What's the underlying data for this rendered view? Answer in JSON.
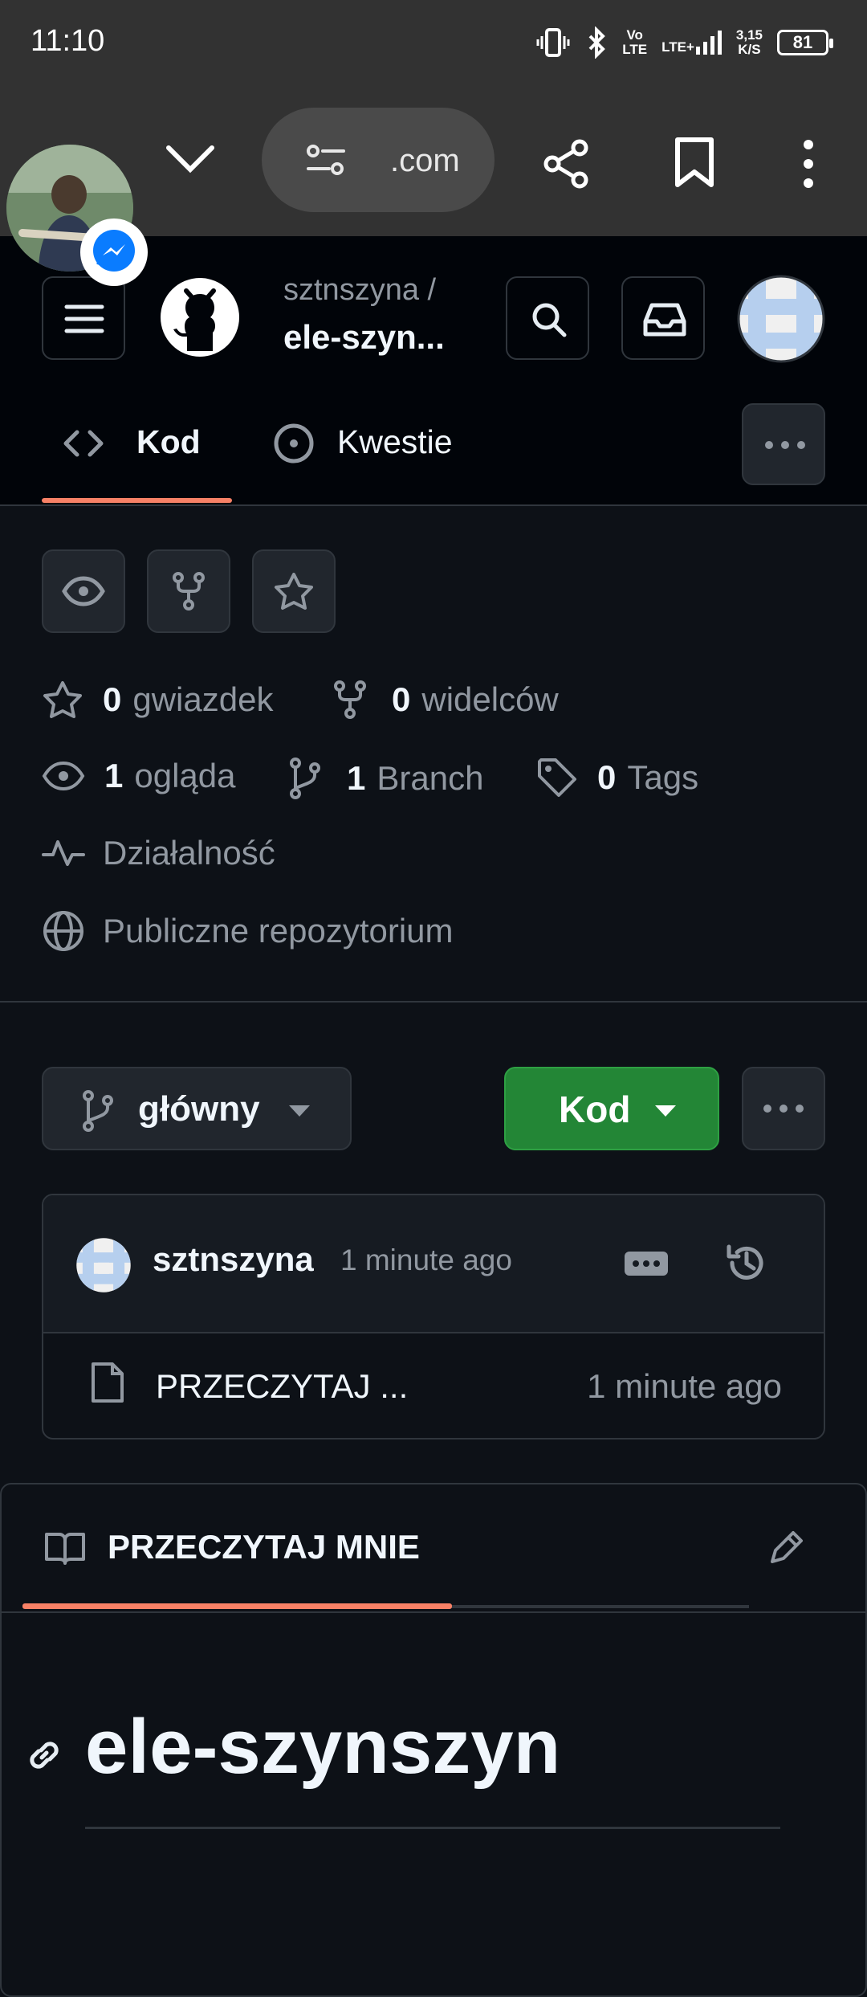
{
  "status_bar": {
    "time": "11:10",
    "volte_top": "Vo",
    "volte_bottom": "LTE",
    "network": "LTE+",
    "speed_top": "3,15",
    "speed_bottom": "K/S",
    "battery": "81"
  },
  "browser": {
    "url_fragment": ".com"
  },
  "repo": {
    "owner": "sztnszyna /",
    "name": "ele-szyn..."
  },
  "tabs": {
    "code": "Kod",
    "issues": "Kwestie"
  },
  "stats": {
    "stars_count": "0",
    "stars_label": "gwiazdek",
    "forks_count": "0",
    "forks_label": "widelców",
    "watching_count": "1",
    "watching_label": "ogląda",
    "branch_count": "1",
    "branch_label": "Branch",
    "tags_count": "0",
    "tags_label": "Tags",
    "activity_label": "Działalność",
    "visibility_label": "Publiczne repozytorium"
  },
  "branch": {
    "name": "główny"
  },
  "code_button": {
    "label": "Kod"
  },
  "commit": {
    "author": "sztnszyna",
    "time": "1 minute ago"
  },
  "files": [
    {
      "name": "PRZECZYTAJ ...",
      "time": "1 minute ago"
    }
  ],
  "readme": {
    "tab_label": "PRZECZYTAJ MNIE",
    "heading": "ele-szynszyn"
  },
  "colors": {
    "accent_underline": "#f78166",
    "code_button_bg": "#238636",
    "messenger": "#0a7cff"
  }
}
